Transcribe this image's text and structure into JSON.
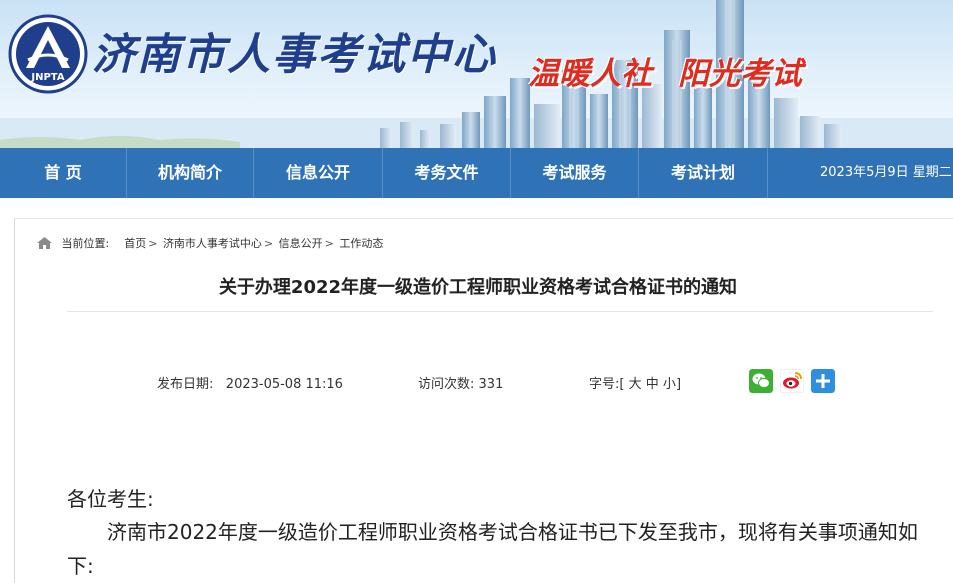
{
  "header": {
    "logo_text": "JNPTA",
    "site_title": "济南市人事考试中心",
    "slogan_left": "温暖人社",
    "slogan_right": "阳光考试"
  },
  "nav": {
    "items": [
      {
        "label": "首 页"
      },
      {
        "label": "机构简介"
      },
      {
        "label": "信息公开"
      },
      {
        "label": "考务文件"
      },
      {
        "label": "考试服务"
      },
      {
        "label": "考试计划"
      }
    ],
    "date": "2023年5月9日 星期二"
  },
  "breadcrumb": {
    "prefix": "当前位置:",
    "items": [
      "首页",
      "济南市人事考试中心",
      "信息公开",
      "工作动态"
    ],
    "separator": ">"
  },
  "article": {
    "title": "关于办理2022年度一级造价工程师职业资格考试合格证书的通知",
    "publish_label": "发布日期:",
    "publish_date": "2023-05-08 11:16",
    "visits_label": "访问次数:",
    "visits": "331",
    "font_label": "字号:",
    "font_open": "[",
    "font_large": "大",
    "font_medium": "中",
    "font_small": "小",
    "font_close": "]",
    "greeting": "各位考生:",
    "paragraph": "济南市2022年度一级造价工程师职业资格考试合格证书已下发至我市，现将有关事项通知如下:"
  },
  "share": {
    "icons": [
      "wechat-icon",
      "weibo-icon",
      "more-share-icon"
    ]
  },
  "colors": {
    "nav_bg": "#2f72b5",
    "title_blue": "#1f3f8c",
    "slogan_red": "#e02b20"
  }
}
